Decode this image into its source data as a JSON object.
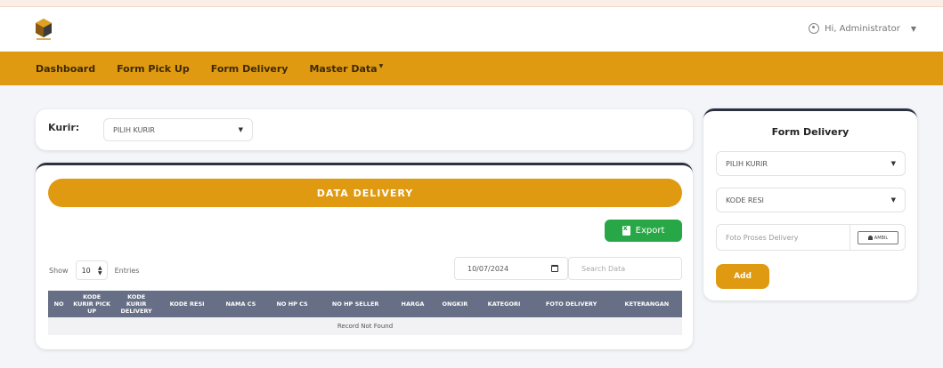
{
  "header": {
    "greeting": "Hi, Administrator"
  },
  "nav": {
    "items": [
      "Dashboard",
      "Form Pick Up",
      "Form Delivery",
      "Master Data"
    ]
  },
  "kurir": {
    "label": "Kurir:",
    "select_value": "PILIH KURIR"
  },
  "data_card": {
    "title": "DATA DELIVERY",
    "export_label": "Export",
    "show_label": "Show",
    "entries_value": "10",
    "entries_label": "Entries",
    "date_value": "10/07/2024",
    "search_placeholder": "Search Data",
    "columns": [
      "NO",
      "KODE KURIR PICK UP",
      "KODE KURIR DELIVERY",
      "KODE RESI",
      "NAMA CS",
      "NO HP CS",
      "NO HP SELLER",
      "HARGA",
      "ONGKIR",
      "KATEGORI",
      "FOTO DELIVERY",
      "KETERANGAN"
    ],
    "empty_message": "Record Not Found"
  },
  "form": {
    "title": "Form Delivery",
    "kurir_select": "PILIH KURIR",
    "resi_select": "KODE RESI",
    "file_placeholder": "Foto Proses Delivery",
    "file_button": "AMBIL",
    "add_label": "Add"
  },
  "colors": {
    "accent": "#df9a12",
    "export": "#27a745",
    "table_header": "#676f86",
    "dark_border": "#2c3140"
  },
  "icons": {
    "logo": "logo-icon",
    "user": "user-circle-icon",
    "export": "excel-file-icon",
    "calendar": "calendar-icon",
    "camera": "camera-icon"
  }
}
